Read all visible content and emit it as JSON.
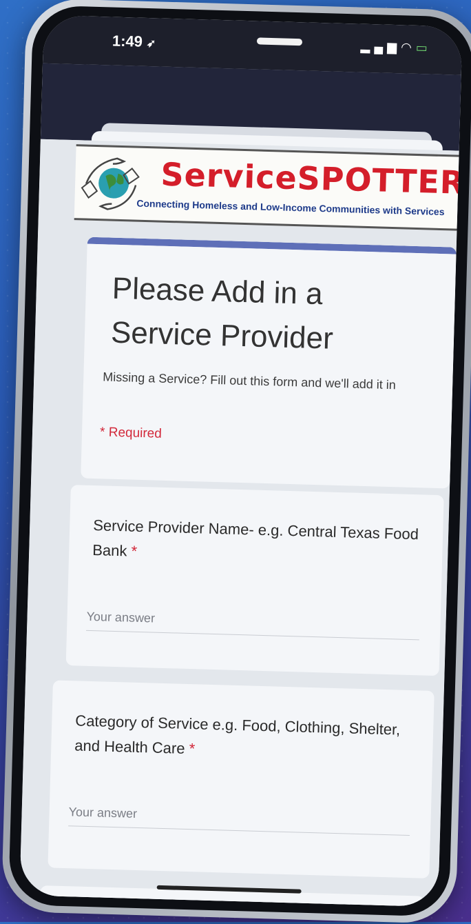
{
  "status": {
    "time": "1:49",
    "location_icon": "location-arrow-icon",
    "signal_icon": "cellular-signal-icon",
    "wifi_icon": "wifi-icon",
    "battery_icon": "battery-charging-icon"
  },
  "browser": {
    "menu_icon": "hamburger-menu-icon"
  },
  "banner": {
    "brand": "ServiceSPOTTER",
    "tagline": "Connecting Homeless and Low-Income Communities with Services",
    "logo_icon": "hands-globe-logo",
    "brand_color": "#d41e2a",
    "tagline_color": "#1e3b8a"
  },
  "form": {
    "title_line1": "Please Add in a",
    "title_line2": "Service Provider",
    "description": "Missing a Service? Fill out this form and we'll add it in",
    "required_note": "* Required",
    "accent_color": "#5e6fb8",
    "questions": [
      {
        "label": "Service Provider Name- e.g. Central Texas Food Bank",
        "required_mark": "*",
        "placeholder": "Your answer"
      },
      {
        "label": "Category of Service e.g. Food, Clothing, Shelter, and Health Care",
        "required_mark": "*",
        "placeholder": "Your answer"
      }
    ]
  }
}
